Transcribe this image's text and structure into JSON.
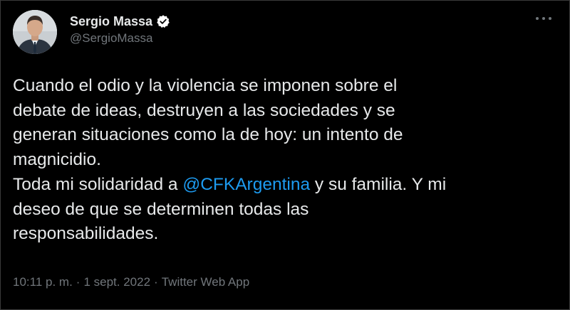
{
  "author": {
    "display_name": "Sergio Massa",
    "handle": "@SergioMassa",
    "verified": true,
    "avatar_icon": "profile-photo-avatar"
  },
  "menu": {
    "icon": "more-options-icon"
  },
  "tweet": {
    "lines": [
      "Cuando el odio y la violencia se imponen sobre el",
      "debate de ideas, destruyen a las sociedades y se",
      "generan situaciones como la de hoy: un intento de",
      "magnicidio."
    ],
    "line5_before": "Toda mi solidaridad a ",
    "mention": "@CFKArgentina",
    "line5_after": " y su familia. Y mi",
    "line6": "deseo de que se determinen todas las",
    "line7": "responsabilidades."
  },
  "meta": {
    "time": "10:11 p. m.",
    "date": "1 sept. 2022",
    "source": "Twitter Web App",
    "separator": "·"
  },
  "colors": {
    "background": "#000000",
    "text": "#e7e9ea",
    "secondary": "#71767b",
    "link": "#1d9bf0",
    "verified_badge": "#ffffff"
  }
}
